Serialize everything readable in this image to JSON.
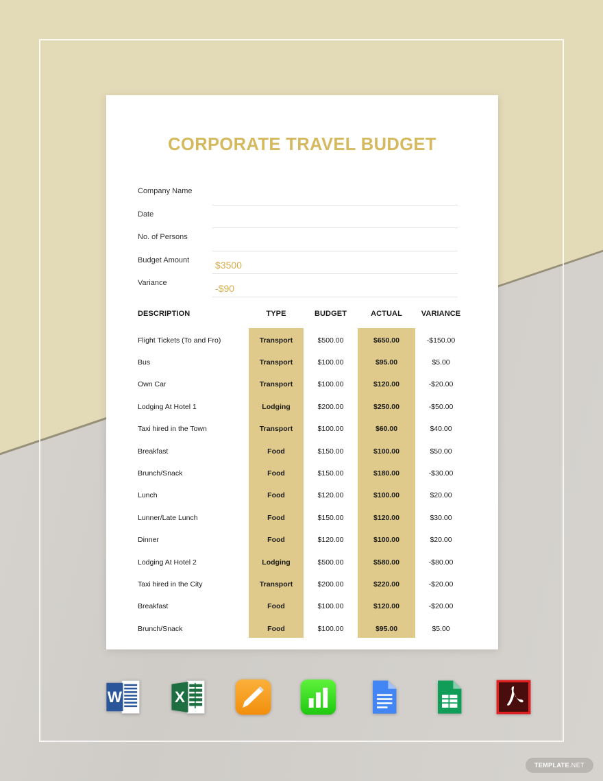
{
  "document": {
    "title": "CORPORATE TRAVEL BUDGET",
    "accent_color": "#d4b95e",
    "band_color": "#dfca8b",
    "background_color": "#e3dab8",
    "wedge_color": "#d5d2ce"
  },
  "form": {
    "fields": [
      {
        "label": "Company Name",
        "value": ""
      },
      {
        "label": "Date",
        "value": ""
      },
      {
        "label": "No. of Persons",
        "value": ""
      },
      {
        "label": "Budget Amount",
        "value": "$3500"
      },
      {
        "label": "Variance",
        "value": "-$90"
      }
    ]
  },
  "table": {
    "headers": {
      "description": "DESCRIPTION",
      "type": "TYPE",
      "budget": "BUDGET",
      "actual": "ACTUAL",
      "variance": "VARIANCE"
    },
    "rows": [
      {
        "description": "Flight Tickets (To and Fro)",
        "type": "Transport",
        "budget": "$500.00",
        "actual": "$650.00",
        "variance": "-$150.00"
      },
      {
        "description": "Bus",
        "type": "Transport",
        "budget": "$100.00",
        "actual": "$95.00",
        "variance": "$5.00"
      },
      {
        "description": "Own Car",
        "type": "Transport",
        "budget": "$100.00",
        "actual": "$120.00",
        "variance": "-$20.00"
      },
      {
        "description": "Lodging At Hotel 1",
        "type": "Lodging",
        "budget": "$200.00",
        "actual": "$250.00",
        "variance": "-$50.00"
      },
      {
        "description": "Taxi hired in the Town",
        "type": "Transport",
        "budget": "$100.00",
        "actual": "$60.00",
        "variance": "$40.00"
      },
      {
        "description": "Breakfast",
        "type": "Food",
        "budget": "$150.00",
        "actual": "$100.00",
        "variance": "$50.00"
      },
      {
        "description": "Brunch/Snack",
        "type": "Food",
        "budget": "$150.00",
        "actual": "$180.00",
        "variance": "-$30.00"
      },
      {
        "description": "Lunch",
        "type": "Food",
        "budget": "$120.00",
        "actual": "$100.00",
        "variance": "$20.00"
      },
      {
        "description": "Lunner/Late Lunch",
        "type": "Food",
        "budget": "$150.00",
        "actual": "$120.00",
        "variance": "$30.00"
      },
      {
        "description": "Dinner",
        "type": "Food",
        "budget": "$120.00",
        "actual": "$100.00",
        "variance": "$20.00"
      },
      {
        "description": "Lodging At Hotel 2",
        "type": "Lodging",
        "budget": "$500.00",
        "actual": "$580.00",
        "variance": "-$80.00"
      },
      {
        "description": "Taxi hired in the City",
        "type": "Transport",
        "budget": "$200.00",
        "actual": "$220.00",
        "variance": "-$20.00"
      },
      {
        "description": "Breakfast",
        "type": "Food",
        "budget": "$100.00",
        "actual": "$120.00",
        "variance": "-$20.00"
      },
      {
        "description": "Brunch/Snack",
        "type": "Food",
        "budget": "$100.00",
        "actual": "$95.00",
        "variance": "$5.00"
      }
    ]
  },
  "formats": {
    "icons": [
      {
        "name": "microsoft-word-icon",
        "label": "Microsoft Word"
      },
      {
        "name": "microsoft-excel-icon",
        "label": "Microsoft Excel"
      },
      {
        "name": "apple-pages-icon",
        "label": "Apple Pages"
      },
      {
        "name": "apple-numbers-icon",
        "label": "Apple Numbers"
      },
      {
        "name": "google-docs-icon",
        "label": "Google Docs"
      },
      {
        "name": "google-sheets-icon",
        "label": "Google Sheets"
      },
      {
        "name": "adobe-pdf-icon",
        "label": "PDF"
      }
    ]
  },
  "watermark": {
    "brand": "TEMPLATE",
    "suffix": ".NET"
  }
}
